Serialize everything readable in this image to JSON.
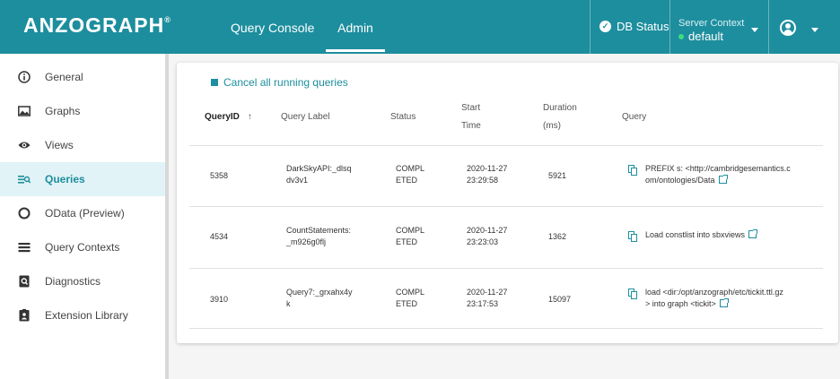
{
  "header": {
    "logo": "ANZOGRAPH",
    "logo_mark": "®",
    "tabs": [
      {
        "label": "Query Console"
      },
      {
        "label": "Admin"
      }
    ],
    "db_status": "DB Status",
    "server_context_label": "Server Context",
    "server_context_value": "default"
  },
  "sidebar": {
    "items": [
      {
        "label": "General",
        "icon": "info-icon"
      },
      {
        "label": "Graphs",
        "icon": "image-icon"
      },
      {
        "label": "Views",
        "icon": "eye-icon"
      },
      {
        "label": "Queries",
        "icon": "query-list-icon"
      },
      {
        "label": "OData (Preview)",
        "icon": "circle-icon"
      },
      {
        "label": "Query Contexts",
        "icon": "list-icon"
      },
      {
        "label": "Diagnostics",
        "icon": "search-doc-icon"
      },
      {
        "label": "Extension Library",
        "icon": "badge-icon"
      }
    ]
  },
  "main": {
    "cancel_label": "Cancel all running queries",
    "columns": {
      "query_id": "QueryID",
      "label": "Query Label",
      "status": "Status",
      "start_time": "Start Time",
      "start_time_l1": "Start",
      "start_time_l2": "Time",
      "duration_l1": "Duration",
      "duration_l2": "(ms)",
      "query": "Query"
    },
    "rows": [
      {
        "id": "5358",
        "label_l1": "DarkSkyAPI:_dlsq",
        "label_l2": "dv3v1",
        "status_l1": "COMPL",
        "status_l2": "ETED",
        "date": "2020-11-27",
        "time": "23:29:58",
        "duration": "5921",
        "query_l1": "PREFIX s: <http://cambridgesemantics.c",
        "query_l2": "om/ontologies/Data"
      },
      {
        "id": "4534",
        "label_l1": "CountStatements:",
        "label_l2": "_m926g0flj",
        "status_l1": "COMPL",
        "status_l2": "ETED",
        "date": "2020-11-27",
        "time": "23:23:03",
        "duration": "1362",
        "query_l1": "Load constlist into sbxviews",
        "query_l2": ""
      },
      {
        "id": "3910",
        "label_l1": "Query7:_grxahx4y",
        "label_l2": "k",
        "status_l1": "COMPL",
        "status_l2": "ETED",
        "date": "2020-11-27",
        "time": "23:17:53",
        "duration": "15097",
        "query_l1": "load <dir:/opt/anzograph/etc/tickit.ttl.gz",
        "query_l2": "> into graph <tickit>"
      }
    ]
  },
  "colors": {
    "brand": "#1d8e9e",
    "active_bg": "#e1f3f6"
  }
}
